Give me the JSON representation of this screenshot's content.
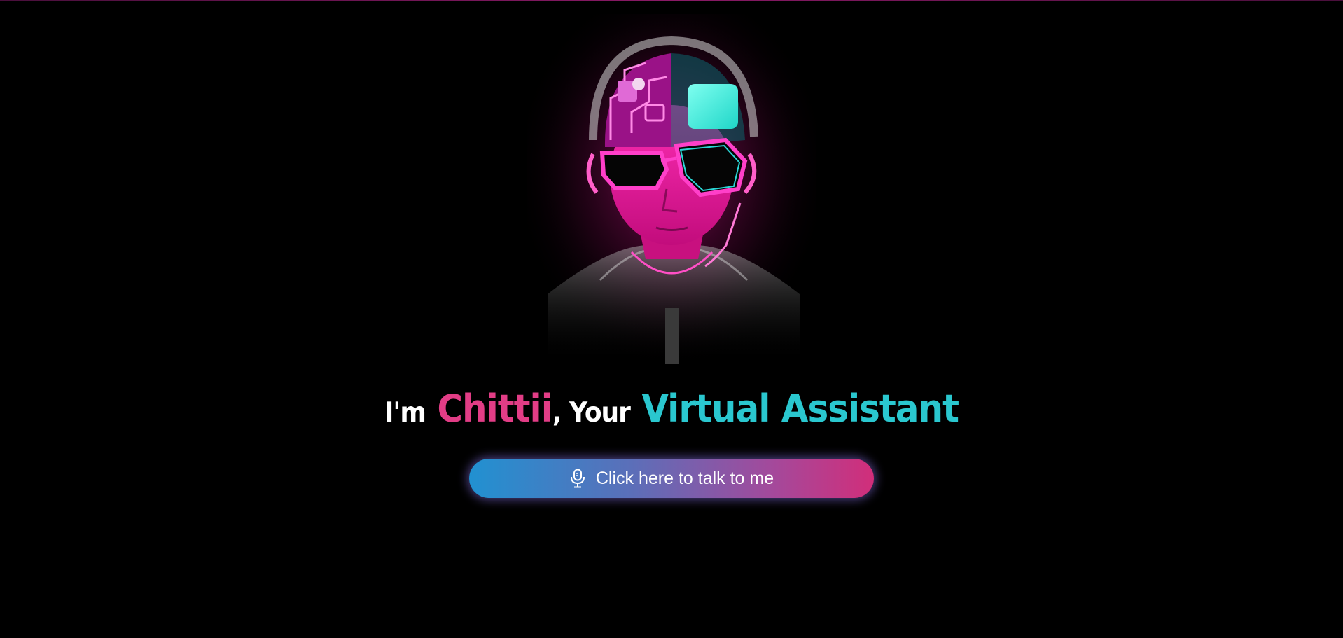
{
  "hero": {
    "avatar_name": "cyberpunk-assistant-avatar",
    "title": {
      "prefix": "I'm",
      "name": "Chittii",
      "middle": ", Your",
      "role": "Virtual Assistant"
    }
  },
  "cta": {
    "label": "Click here to talk to me",
    "icon": "microphone-icon"
  },
  "colors": {
    "background": "#000000",
    "name_pink": "#e23d86",
    "role_cyan": "#2ac7cf",
    "button_start": "#2191d1",
    "button_end": "#d12e7a"
  }
}
